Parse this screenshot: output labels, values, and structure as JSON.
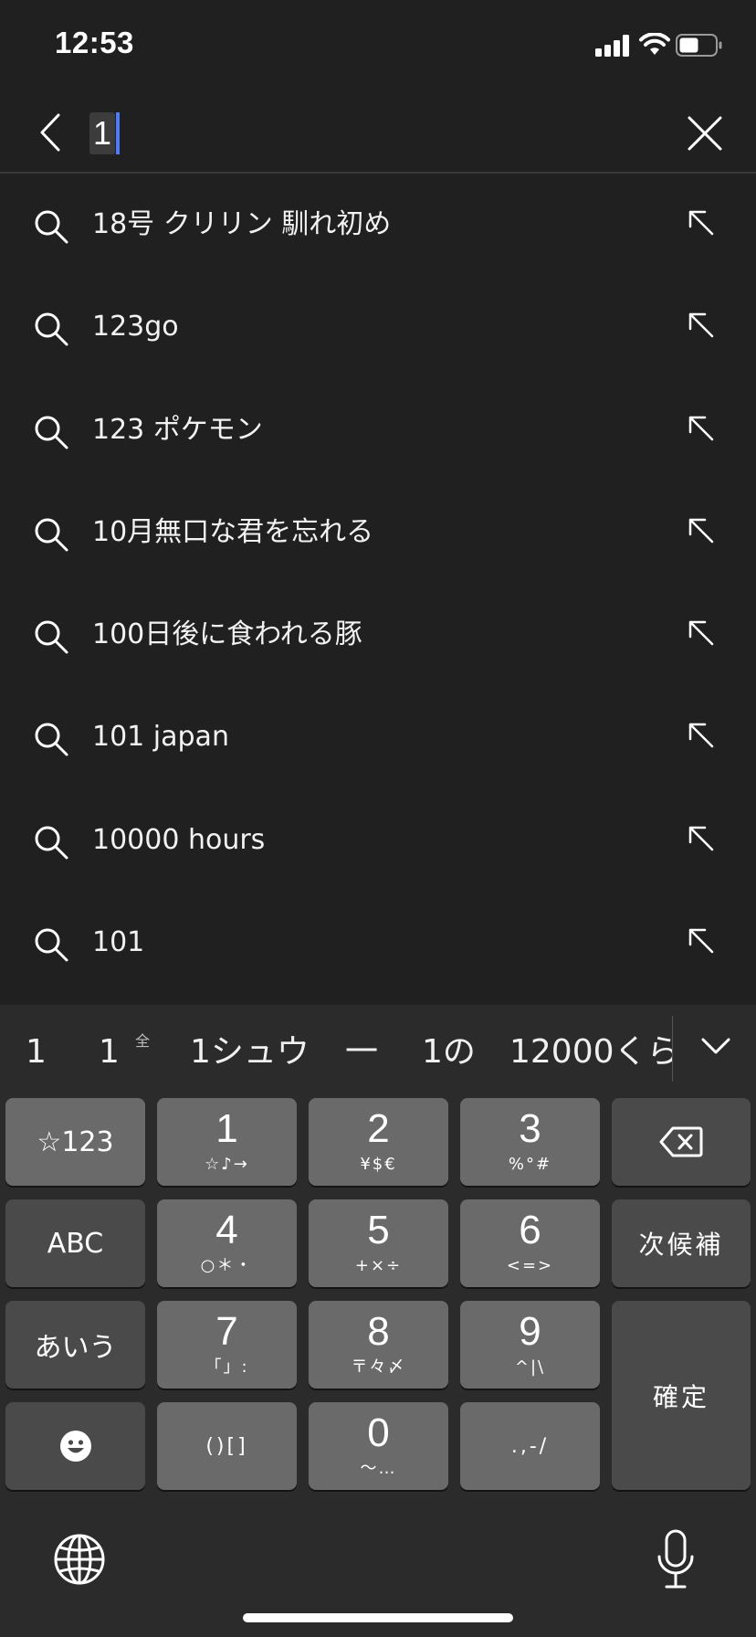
{
  "status_bar": {
    "time": "12:53"
  },
  "search": {
    "query": "1"
  },
  "suggestions": [
    {
      "text": "18号 クリリン 馴れ初め"
    },
    {
      "text": "123go"
    },
    {
      "text": "123 ポケモン"
    },
    {
      "text": "10月無口な君を忘れる"
    },
    {
      "text": "100日後に食われる豚"
    },
    {
      "text": "101 japan"
    },
    {
      "text": "10000 hours"
    },
    {
      "text": "101"
    }
  ],
  "keyboard": {
    "candidates": [
      "1",
      "1",
      "1シュウ",
      "一",
      "1の",
      "12000くら"
    ],
    "candidate_superscript": "全",
    "keys": {
      "symbols": "☆123",
      "k1": {
        "main": "1",
        "sub": "☆♪→"
      },
      "k2": {
        "main": "2",
        "sub": "¥$€"
      },
      "k3": {
        "main": "3",
        "sub": "%°#"
      },
      "abc": "ABC",
      "k4": {
        "main": "4",
        "sub": "○＊・"
      },
      "k5": {
        "main": "5",
        "sub": "+×÷"
      },
      "k6": {
        "main": "6",
        "sub": "<=>"
      },
      "next_candidate": "次候補",
      "kana": "あいう",
      "k7": {
        "main": "7",
        "sub": "「」:"
      },
      "k8": {
        "main": "8",
        "sub": "〒々〆"
      },
      "k9": {
        "main": "9",
        "sub": "^|\\"
      },
      "confirm": "確定",
      "brackets": "()[]",
      "k0": {
        "main": "0",
        "sub": "〜…"
      },
      "punct": ".,-/"
    }
  },
  "colors": {
    "background": "#202020",
    "keyboard": "#2b2b2b",
    "key": "#6a6a6a",
    "key_dark": "#4a4a4a",
    "caret": "#4c7dff"
  }
}
